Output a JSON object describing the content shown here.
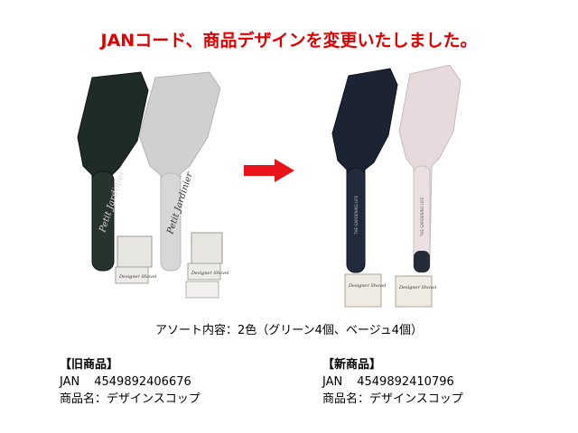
{
  "headline": "JANコード、商品デザインを変更いたしました。",
  "colors": {
    "headline": "#e00000",
    "arrow": "#e8141a",
    "old_dark_trowel": "#1f2b26",
    "old_light_trowel": "#cfd0cf",
    "new_dark_trowel": "#1c2434",
    "new_light_trowel": "#e6dadc"
  },
  "old_product_photo": {
    "dark_handle_script": "Petit Jardinier",
    "light_handle_script": "Petit Jardinier",
    "tag_script": "Designer Shovel"
  },
  "new_product_photo": {
    "dark_handle_text": "THE GARDENING LIFE",
    "light_handle_text": "THE GARDENING LIFE",
    "tag_script": "Designer Shovel"
  },
  "assortment": "アソート内容：2色（グリーン4個、ベージュ4個）",
  "old_product": {
    "heading": "【旧商品】",
    "jan_label": "JAN",
    "jan_code": "4549892406676",
    "name_line": "商品名：デザインスコップ"
  },
  "new_product": {
    "heading": "【新商品】",
    "jan_label": "JAN",
    "jan_code": "4549892410796",
    "name_line": "商品名：デザインスコップ"
  }
}
